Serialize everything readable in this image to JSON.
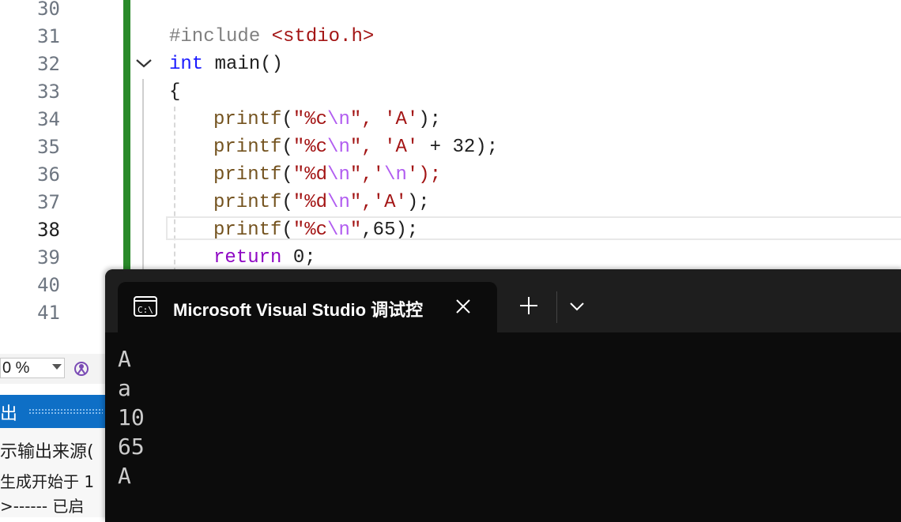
{
  "editor": {
    "line_numbers": [
      "30",
      "31",
      "32",
      "33",
      "34",
      "35",
      "36",
      "37",
      "38",
      "39",
      "40",
      "41"
    ],
    "current_line": "38",
    "code": {
      "l31_directive": "#include",
      "l31_header": "<stdio.h>",
      "l32_type": "int",
      "l32_rest": " main()",
      "l33": "{",
      "printf": "printf",
      "l34_fmt": "\"%c",
      "esc_n": "\\n",
      "quote": "\"",
      "l34_arg": ", 'A'",
      "l34_end": ");",
      "l35_arg": ", 'A'",
      "l35_tail": " + 32);",
      "l36_fmt": "\"%d",
      "l36_mid": ",'",
      "l36_end": "');",
      "l37_fmt": "\"%d",
      "l37_arg": ",'A'",
      "l37_end": ");",
      "l38_fmt": "\"%c",
      "l38_tail": ",65);",
      "l39_kw": "return",
      "l39_tail": " 0;"
    }
  },
  "bottom_left": {
    "zoom_value": "0 %",
    "cleanup_icon": "code-cleanup-icon",
    "output_title": "出",
    "output_lines": [
      "示输出来源(",
      "生成开始于 1",
      ">------ 已启"
    ]
  },
  "terminal": {
    "tab_icon": "console-icon",
    "tab_title": "Microsoft Visual Studio 调试控",
    "close_icon": "close-icon",
    "new_tab_icon": "plus-icon",
    "dropdown_icon": "chevron-down-icon",
    "output": [
      "A",
      "a",
      "10",
      "65",
      "A"
    ]
  },
  "colors": {
    "change_bar": "#2a8a2a",
    "keyword": "#1a1aff",
    "string": "#a31515",
    "escape": "#b15cf0",
    "control_keyword": "#8f08c4",
    "output_header": "#0e6fc6",
    "terminal_bg": "#0c0c0c"
  }
}
